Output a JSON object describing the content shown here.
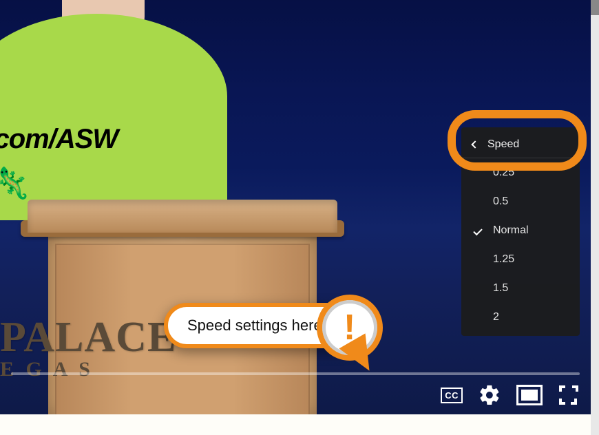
{
  "video_scene": {
    "shirt_text": "la.com/ASW",
    "palace_text": "PALACE",
    "egas_text": "E G A S"
  },
  "speed_menu": {
    "title": "Speed",
    "items": [
      {
        "label": "0.25",
        "selected": false
      },
      {
        "label": "0.5",
        "selected": false
      },
      {
        "label": "Normal",
        "selected": true
      },
      {
        "label": "1.25",
        "selected": false
      },
      {
        "label": "1.5",
        "selected": false
      },
      {
        "label": "2",
        "selected": false
      }
    ]
  },
  "annotation": {
    "text": "Speed settings here"
  },
  "controls": {
    "cc_label": "CC"
  }
}
